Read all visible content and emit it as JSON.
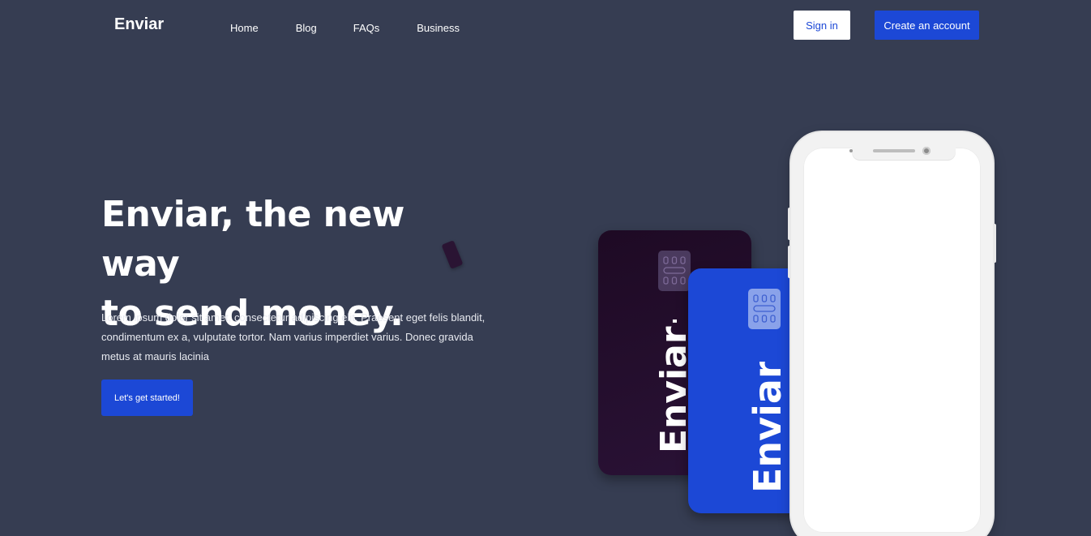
{
  "header": {
    "logo": "Enviar",
    "nav": [
      "Home",
      "Blog",
      "FAQs",
      "Business"
    ],
    "sign_in_label": "Sign in",
    "create_account_label": "Create an account"
  },
  "hero": {
    "title_line1": "Enviar, the new way",
    "title_line2": "to send money.",
    "description": "Lorem ipsum dolor sit amet, consectetur adipiscing elit. Praesent eget felis blandit, condimentum ex a, vulputate tortor. Nam varius imperdiet varius. Donec gravida metus at mauris lacinia",
    "cta_label": "Let's get started!"
  },
  "cards": {
    "dark_card_label": "Enviar+",
    "blue_card_label": "Enviar"
  },
  "colors": {
    "background": "#363d52",
    "accent": "#1c48d6",
    "dark_card": "#22102b"
  }
}
